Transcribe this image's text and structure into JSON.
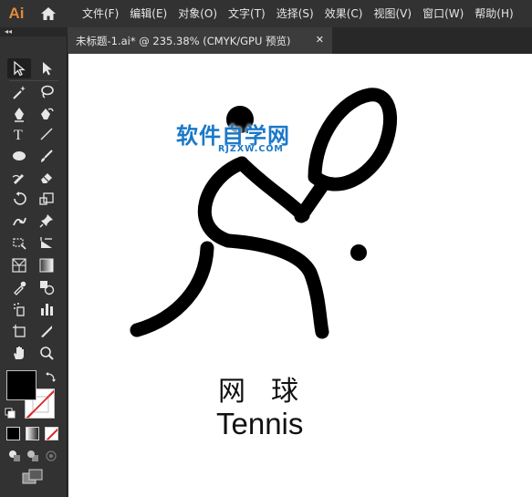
{
  "app": {
    "logo": "Ai"
  },
  "menu": [
    "文件(F)",
    "编辑(E)",
    "对象(O)",
    "文字(T)",
    "选择(S)",
    "效果(C)",
    "视图(V)",
    "窗口(W)",
    "帮助(H)"
  ],
  "document_tab": {
    "label": "未标题-1.ai* @ 235.38% (CMYK/GPU 预览)",
    "close": "✕"
  },
  "panel_collapse": "◂◂",
  "tools": [
    "selection-tool",
    "direct-selection-tool",
    "magic-wand-tool",
    "lasso-tool",
    "pen-tool",
    "curvature-tool",
    "type-tool",
    "line-segment-tool",
    "ellipse-tool",
    "paintbrush-tool",
    "shaper-tool",
    "eraser-tool",
    "rotate-tool",
    "scale-tool",
    "puppet-warp-tool",
    "pin-tool",
    "free-transform-tool",
    "shape-builder-tool",
    "perspective-grid-tool",
    "gradient-tool",
    "eyedropper-tool",
    "blend-tool",
    "symbol-sprayer-tool",
    "column-graph-tool",
    "artboard-tool",
    "slice-tool",
    "hand-tool",
    "zoom-tool"
  ],
  "colors": {
    "fill": "#000000",
    "stroke": "none",
    "accent_logo": "#e08a3c",
    "watermark": "#1a78c8"
  },
  "canvas": {
    "watermark_title": "软件自学网",
    "watermark_url": "RJZXW.COM",
    "title_cn": "网球",
    "title_en": "Tennis"
  }
}
